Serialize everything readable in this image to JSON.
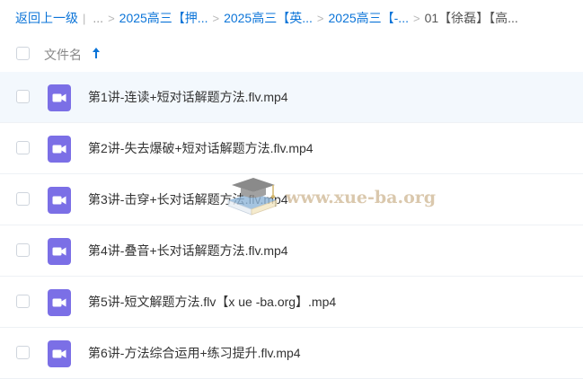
{
  "breadcrumb": {
    "back_label": "返回上一级",
    "ellipsis": "...",
    "items": [
      {
        "label": "2025高三【押..."
      },
      {
        "label": "2025高三【英..."
      },
      {
        "label": "2025高三【-..."
      }
    ],
    "current": "01【徐磊】【高..."
  },
  "header": {
    "name_column": "文件名",
    "sort_icon": "arrow-up-icon"
  },
  "files": [
    {
      "name": "第1讲-连读+短对话解题方法.flv.mp4",
      "icon": "video-file-icon"
    },
    {
      "name": "第2讲-失去爆破+短对话解题方法.flv.mp4",
      "icon": "video-file-icon"
    },
    {
      "name": "第3讲-击穿+长对话解题方法.flv.mp4",
      "icon": "video-file-icon"
    },
    {
      "name": "第4讲-叠音+长对话解题方法.flv.mp4",
      "icon": "video-file-icon"
    },
    {
      "name": "第5讲-短文解题方法.flv【x ue -ba.org】.mp4",
      "icon": "video-file-icon"
    },
    {
      "name": "第6讲-方法综合运用+练习提升.flv.mp4",
      "icon": "video-file-icon"
    }
  ],
  "watermark": {
    "text": "www.xue-ba.org",
    "icon": "graduation-cap-book-icon"
  },
  "colors": {
    "link": "#0b74d8",
    "video_icon": "#7b6fe6",
    "hover_row": "#f3f8fd"
  }
}
